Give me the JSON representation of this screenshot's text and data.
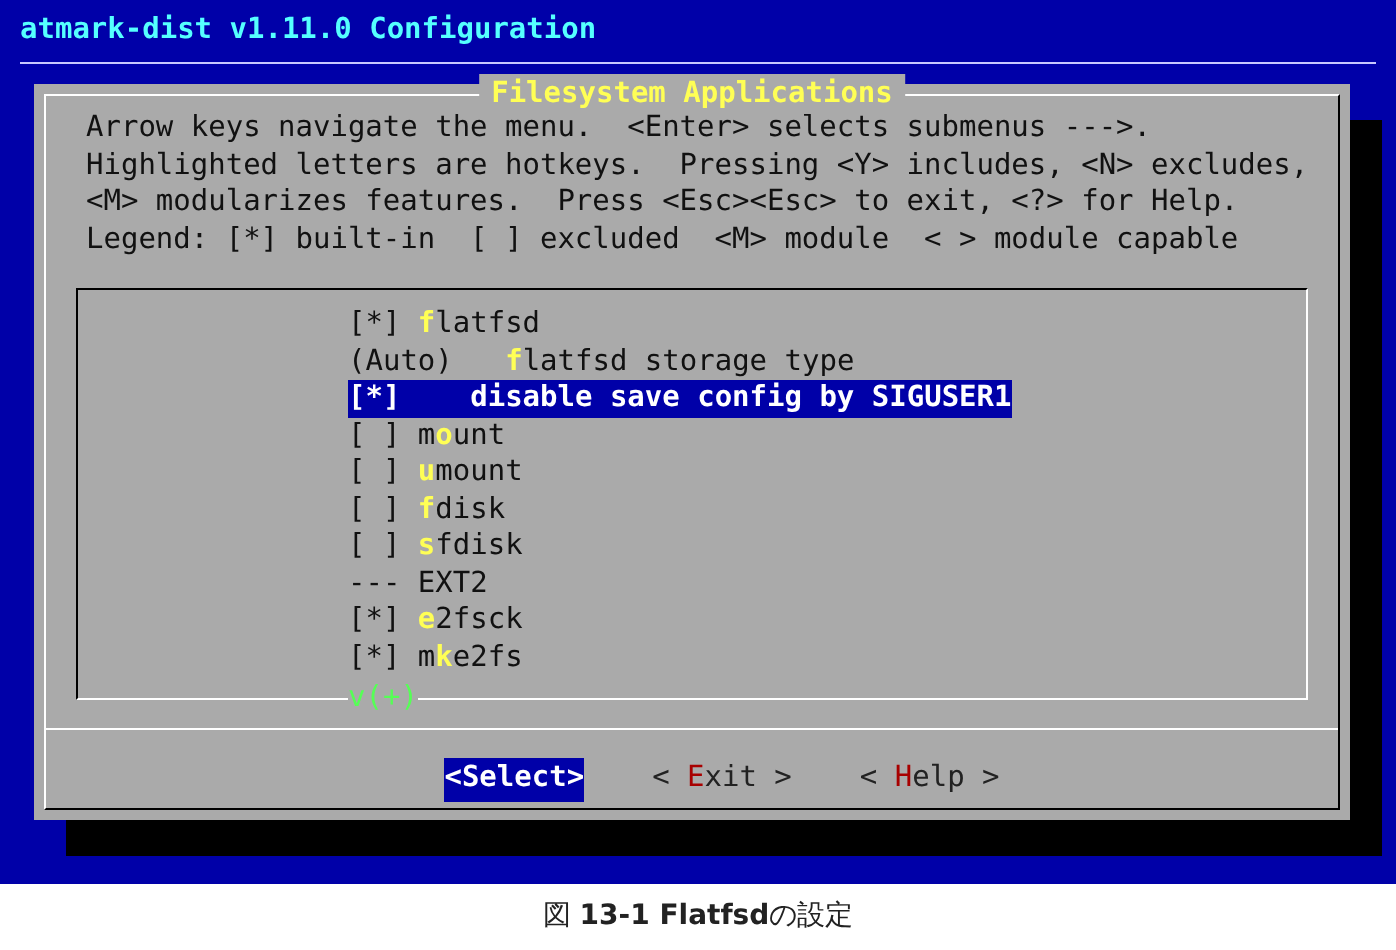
{
  "screen_title": "atmark-dist v1.11.0 Configuration",
  "dialog": {
    "title": "Filesystem Applications",
    "help_lines": [
      "Arrow keys navigate the menu.  <Enter> selects submenus --->.",
      "Highlighted letters are hotkeys.  Pressing <Y> includes, <N> excludes,",
      "<M> modularizes features.  Press <Esc><Esc> to exit, <?> for Help.",
      "Legend: [*] built-in  [ ] excluded  <M> module  < > module capable"
    ],
    "items": [
      {
        "prefix": "[*]",
        "hotkey": "f",
        "after": "latfsd",
        "selected": false
      },
      {
        "prefix": "(Auto)  ",
        "hotkey": "f",
        "after": "latfsd storage type",
        "selected": false
      },
      {
        "prefix": "[*]",
        "before": "   disable save config by SIGUSER1",
        "selected": true
      },
      {
        "prefix": "[ ]",
        "before": "m",
        "hotkey": "o",
        "after": "unt",
        "selected": false
      },
      {
        "prefix": "[ ]",
        "hotkey": "u",
        "after": "mount",
        "selected": false
      },
      {
        "prefix": "[ ]",
        "hotkey": "f",
        "after": "disk",
        "selected": false
      },
      {
        "prefix": "[ ]",
        "hotkey": "s",
        "after": "fdisk",
        "selected": false
      },
      {
        "prefix": "---",
        "before": "EXT2",
        "selected": false
      },
      {
        "prefix": "[*]",
        "hotkey": "e",
        "after": "2fsck",
        "selected": false
      },
      {
        "prefix": "[*]",
        "before": "m",
        "hotkey": "k",
        "after": "e2fs",
        "selected": false
      }
    ],
    "more_indicator": "v(+)",
    "buttons": [
      {
        "before": "<Select>",
        "selected": true
      },
      {
        "before": "< ",
        "hotkey": "E",
        "after": "xit >",
        "selected": false
      },
      {
        "before": "< ",
        "hotkey": "H",
        "after": "elp >",
        "selected": false
      }
    ]
  },
  "caption": "図 **13-1 Flatfsd**の設定"
}
